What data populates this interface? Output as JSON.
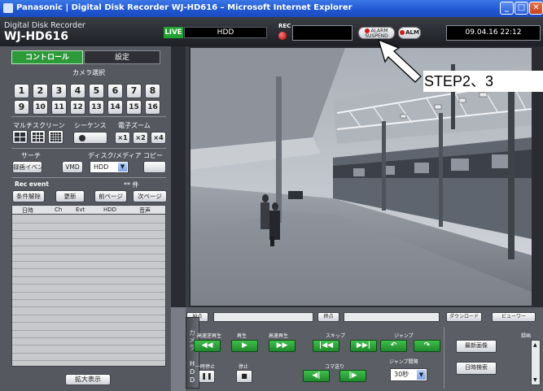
{
  "window": {
    "title": "Panasonic | Digital Disk Recorder WJ-HD616 – Microsoft Internet Explorer",
    "buttons": {
      "minimize": "_",
      "maximize": "□",
      "close": "✕"
    }
  },
  "header": {
    "product_line": "Digital Disk Recorder",
    "model": "WJ-HD616",
    "live": "LIVE",
    "source": "HDD",
    "rec": "REC",
    "alarm_suspend": "ALARM SUSPEND",
    "alm": "ALM",
    "datetime": "09.04.16  22:12"
  },
  "tabs": {
    "control": "コントロール",
    "settings": "設定"
  },
  "camera_select": {
    "label": "カメラ選択",
    "buttons": [
      "1",
      "2",
      "3",
      "4",
      "5",
      "6",
      "7",
      "8",
      "9",
      "10",
      "11",
      "12",
      "13",
      "14",
      "15",
      "16"
    ]
  },
  "multiscreen": {
    "label": "マルチスクリーン"
  },
  "sequence": {
    "label": "シーケンス"
  },
  "ezoom": {
    "label": "電子ズーム",
    "buttons": [
      "×1",
      "×2",
      "×4"
    ]
  },
  "search": {
    "label": "サーチ",
    "rec_event_button": "録画イベント",
    "vmd_button": "VMD"
  },
  "disk_media": {
    "label": "ディスク/メディア",
    "selected": "HDD"
  },
  "copy": {
    "label": "コピー"
  },
  "rec_event": {
    "title": "Rec event",
    "count": "** 件",
    "buttons": [
      "条件解除",
      "更新",
      "前ページ",
      "次ページ"
    ],
    "columns": [
      "日時",
      "Ch",
      "Evt",
      "HDD",
      "音声"
    ]
  },
  "zoom_display_button": "拡大表示",
  "playback": {
    "start_button": "始点",
    "end_button": "終点",
    "download_button": "ダウンロード",
    "viewer_button": "ビューワー",
    "side_tab_top": "カメラ",
    "side_tab_bottom": "HDD",
    "labels": {
      "fast_rewind": "高速逆再生",
      "play": "再生",
      "fast_forward": "高速再生",
      "skip": "スキップ",
      "jump": "ジャンプ",
      "pause": "一時停止",
      "stop": "停止",
      "frame": "コマ送り",
      "jump_interval": "ジャンプ間隔"
    },
    "jump_interval_value": "30秒",
    "latest_image_button": "最新画像",
    "date_search_button": "日時検索",
    "recording_label": "録画"
  },
  "annotation": "STEP2、3"
}
